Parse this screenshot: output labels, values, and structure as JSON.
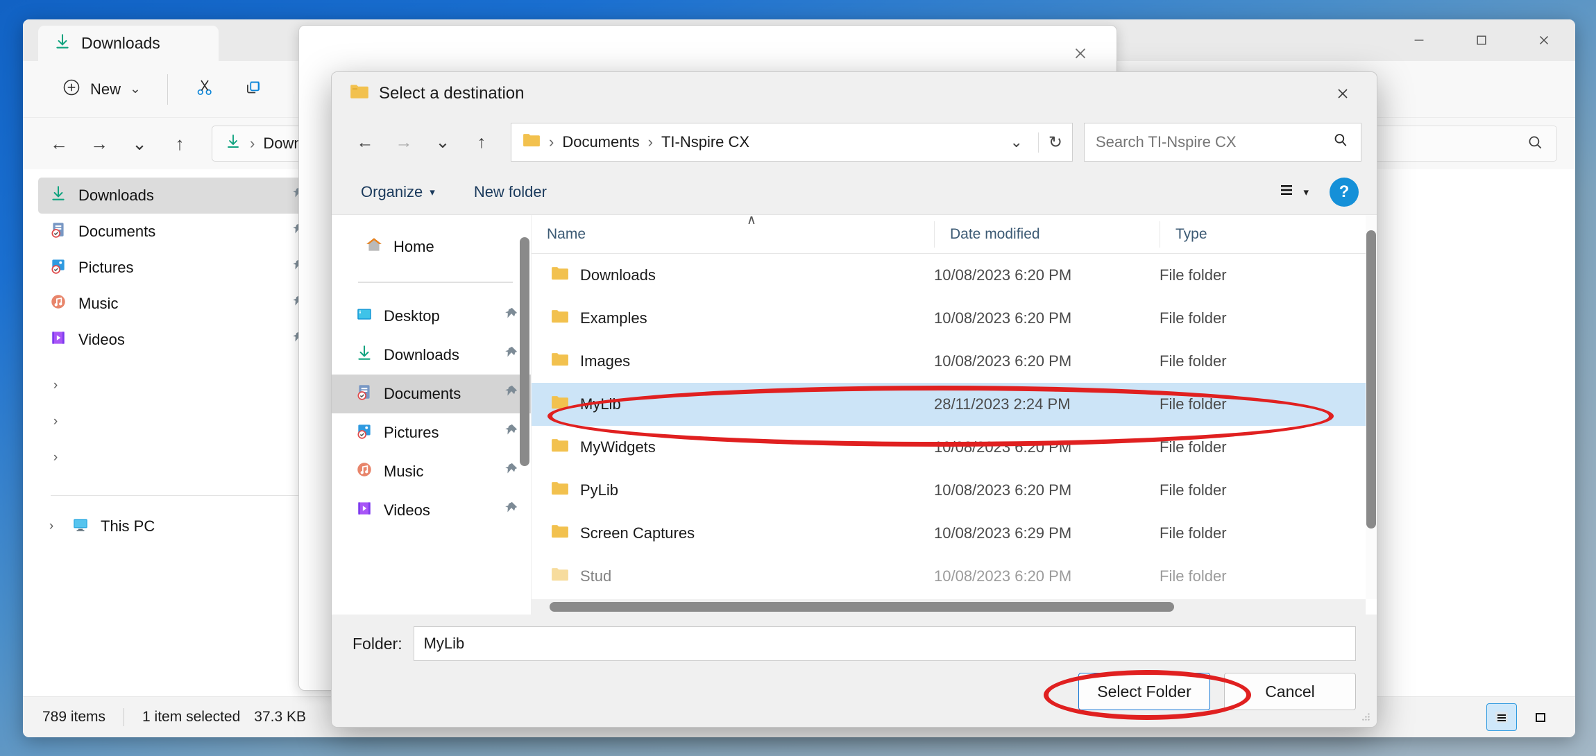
{
  "explorer": {
    "tab_title": "Downloads",
    "window_controls": {
      "minimize": "—",
      "maximize": "☐",
      "close": "✕"
    },
    "ribbon": {
      "new_label": "New",
      "new_caret": "⌄",
      "cut_icon": "scissors-icon",
      "copy_icon": "copy-icon"
    },
    "nav": {
      "back": "←",
      "forward": "→",
      "recent": "⌄",
      "up": "↑",
      "breadcrumb": "Downlo",
      "search_icon": "search-icon"
    },
    "sidebar": [
      {
        "label": "Downloads",
        "icon": "downloads-icon",
        "selected": true,
        "pinned": true
      },
      {
        "label": "Documents",
        "icon": "documents-icon",
        "selected": false,
        "pinned": true
      },
      {
        "label": "Pictures",
        "icon": "pictures-icon",
        "selected": false,
        "pinned": true
      },
      {
        "label": "Music",
        "icon": "music-icon",
        "selected": false,
        "pinned": true
      },
      {
        "label": "Videos",
        "icon": "videos-icon",
        "selected": false,
        "pinned": true
      }
    ],
    "tree": {
      "this_pc": "This PC",
      "chevron": "›"
    },
    "status": {
      "items_count": "789 items",
      "selection": "1 item selected",
      "size": "37.3 KB"
    },
    "view_toggles": {
      "details": "details-view-icon",
      "large_icons": "large-icons-view-icon"
    }
  },
  "behind_window": {
    "close": "✕"
  },
  "dialog": {
    "title": "Select a destination",
    "title_icon": "folder-icon",
    "close": "✕",
    "nav": {
      "back": "←",
      "forward": "→",
      "recent": "⌄",
      "up": "↑",
      "dropdown": "⌄",
      "refresh": "↻"
    },
    "breadcrumb": {
      "icon": "folder-icon",
      "segments": [
        "Documents",
        "TI-Nspire CX"
      ],
      "separator": "›"
    },
    "search": {
      "placeholder": "Search TI-Nspire CX",
      "icon": "search-icon"
    },
    "toolbar": {
      "organize": "Organize",
      "organize_caret": "▾",
      "new_folder": "New folder",
      "view_icon": "view-options-icon",
      "view_caret": "▾",
      "help": "?"
    },
    "sidebar": {
      "home": {
        "label": "Home",
        "icon": "home-icon"
      },
      "items": [
        {
          "label": "Desktop",
          "icon": "desktop-icon",
          "selected": false,
          "pinned": true
        },
        {
          "label": "Downloads",
          "icon": "downloads-icon",
          "selected": false,
          "pinned": true
        },
        {
          "label": "Documents",
          "icon": "documents-icon",
          "selected": true,
          "pinned": true
        },
        {
          "label": "Pictures",
          "icon": "pictures-icon",
          "selected": false,
          "pinned": true
        },
        {
          "label": "Music",
          "icon": "music-icon",
          "selected": false,
          "pinned": true
        },
        {
          "label": "Videos",
          "icon": "videos-icon",
          "selected": false,
          "pinned": true
        }
      ]
    },
    "file_list": {
      "columns": [
        "Name",
        "Date modified",
        "Type"
      ],
      "sort_caret": "∧",
      "rows": [
        {
          "name": "Downloads",
          "date": "10/08/2023 6:20 PM",
          "type": "File folder",
          "selected": false
        },
        {
          "name": "Examples",
          "date": "10/08/2023 6:20 PM",
          "type": "File folder",
          "selected": false
        },
        {
          "name": "Images",
          "date": "10/08/2023 6:20 PM",
          "type": "File folder",
          "selected": false
        },
        {
          "name": "MyLib",
          "date": "28/11/2023 2:24 PM",
          "type": "File folder",
          "selected": true
        },
        {
          "name": "MyWidgets",
          "date": "10/08/2023 6:20 PM",
          "type": "File folder",
          "selected": false
        },
        {
          "name": "PyLib",
          "date": "10/08/2023 6:20 PM",
          "type": "File folder",
          "selected": false
        },
        {
          "name": "Screen Captures",
          "date": "10/08/2023 6:29 PM",
          "type": "File folder",
          "selected": false
        },
        {
          "name": "Stud",
          "date": "10/08/2023 6:20 PM",
          "type": "File folder",
          "selected": false
        }
      ]
    },
    "footer": {
      "folder_label": "Folder:",
      "folder_value": "MyLib",
      "select_button": "Select Folder",
      "cancel_button": "Cancel"
    }
  },
  "annotations": {
    "accent_color": "#e02020",
    "selected_row_highlight": "#cce4f7",
    "marked_row": "MyLib",
    "marked_button": "Select Folder"
  }
}
